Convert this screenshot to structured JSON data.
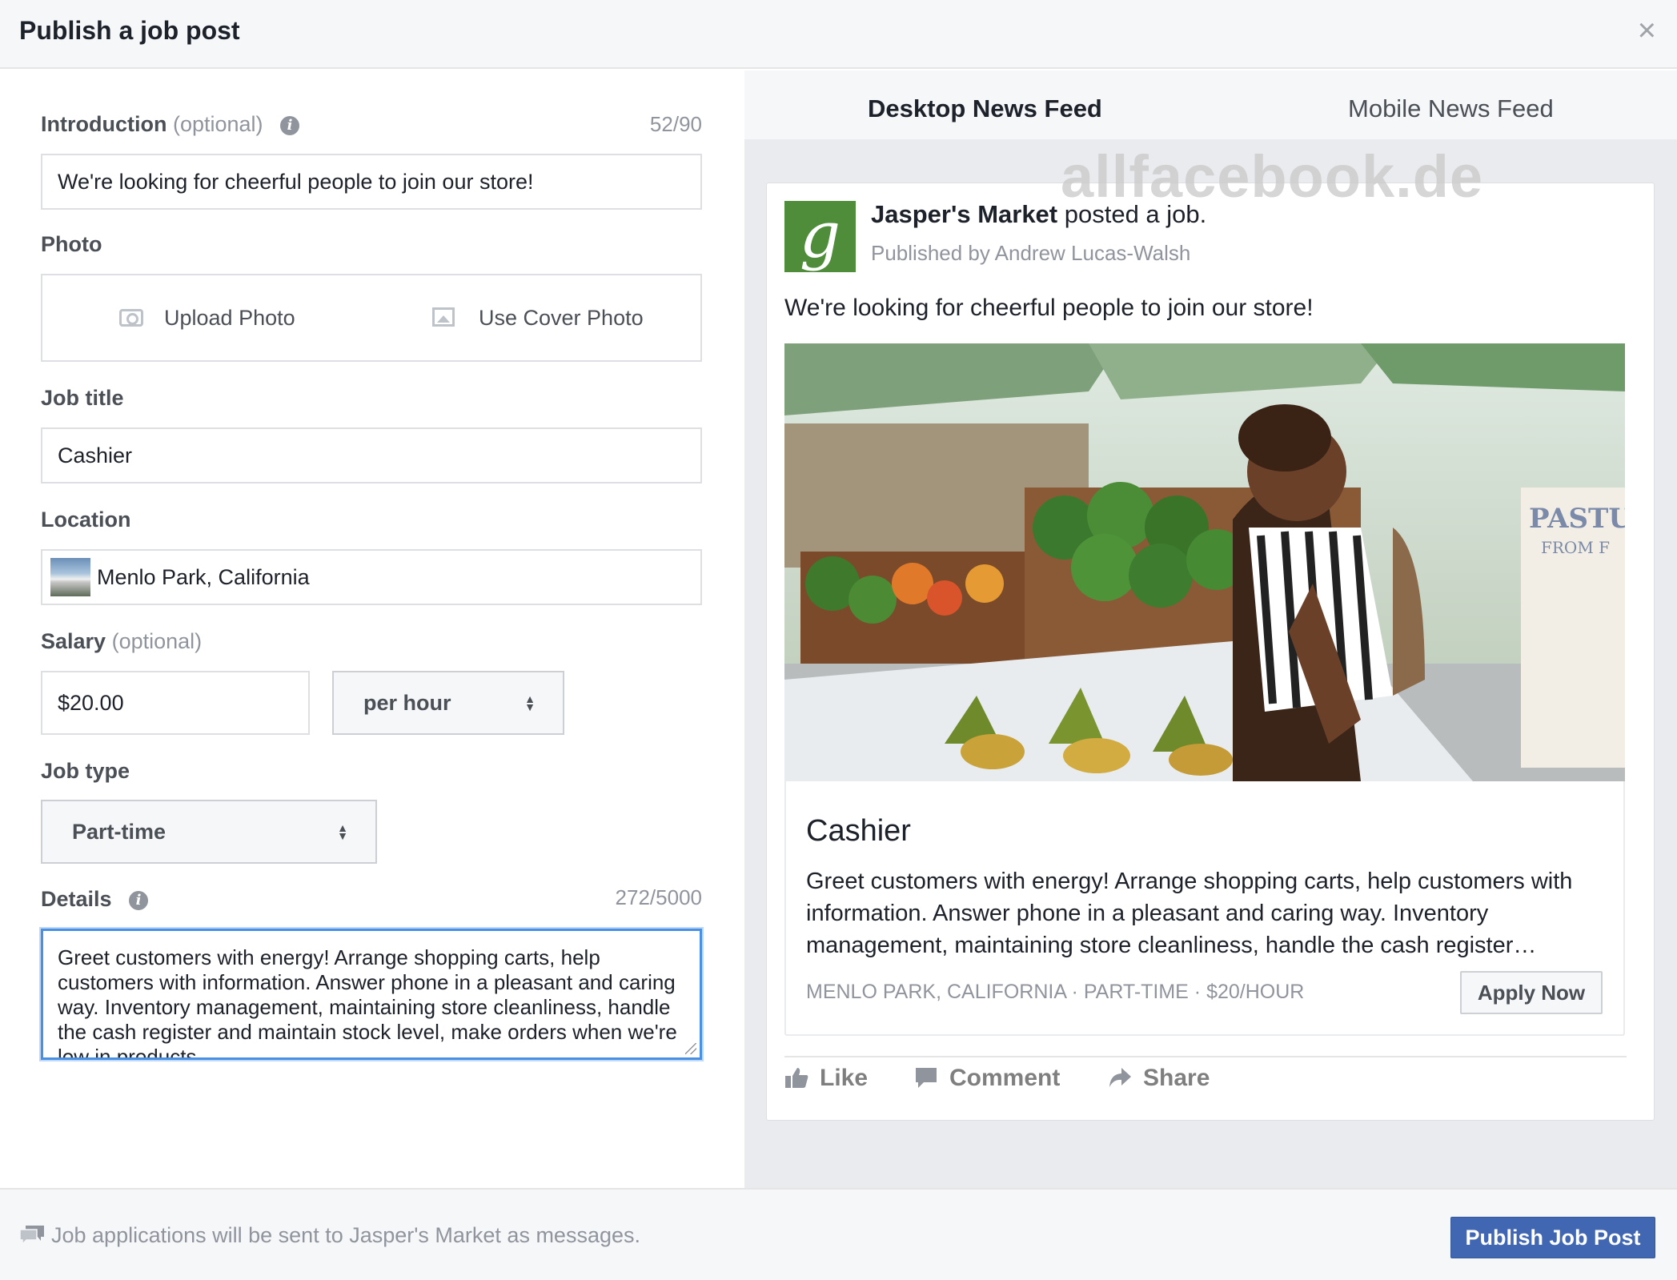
{
  "dialog": {
    "title": "Publish a job post",
    "close_symbol": "×"
  },
  "form": {
    "introduction": {
      "label": "Introduction",
      "optional": "(optional)",
      "info_icon": "i",
      "counter": "52/90",
      "value": "We're looking for cheerful people to join our store!"
    },
    "photo": {
      "label": "Photo",
      "upload_label": "Upload Photo",
      "cover_label": "Use Cover Photo"
    },
    "job_title": {
      "label": "Job title",
      "value": "Cashier"
    },
    "location": {
      "label": "Location",
      "value": "Menlo Park, California"
    },
    "salary": {
      "label": "Salary",
      "optional": "(optional)",
      "amount": "$20.00",
      "period": "per hour"
    },
    "job_type": {
      "label": "Job type",
      "value": "Part-time"
    },
    "details": {
      "label": "Details",
      "info_icon": "i",
      "counter": "272/5000",
      "value": "Greet customers with energy! Arrange shopping carts, help customers with information. Answer phone in a pleasant and caring way. Inventory management, maintaining store cleanliness, handle the cash register and maintain stock level, make orders when we're low in products."
    }
  },
  "preview": {
    "tabs": [
      {
        "label": "Desktop News Feed",
        "active": true
      },
      {
        "label": "Mobile News Feed",
        "active": false
      }
    ],
    "watermark": "allfacebook.de",
    "post": {
      "avatar_letter": "g",
      "page_name": "Jasper's Market",
      "action_text": " posted a job.",
      "published_by": "Published by Andrew Lucas-Walsh",
      "text": "We're looking for cheerful people to join our store!",
      "job_title": "Cashier",
      "job_description": "Greet customers with energy! Arrange shopping carts, help customers with information. Answer phone in a pleasant and caring way. Inventory management, maintaining store cleanliness, handle the cash register…",
      "meta": "MENLO PARK, CALIFORNIA · PART-TIME · $20/HOUR",
      "apply_label": "Apply Now",
      "like_label": "Like",
      "comment_label": "Comment",
      "share_label": "Share"
    }
  },
  "footer": {
    "note": "Job applications will be sent to Jasper's Market as messages.",
    "publish_label": "Publish Job Post"
  },
  "colors": {
    "accent": "#4267b2",
    "focus": "#4a90e2",
    "avatar_green": "#4f8d3a",
    "muted_text": "#90949c"
  }
}
